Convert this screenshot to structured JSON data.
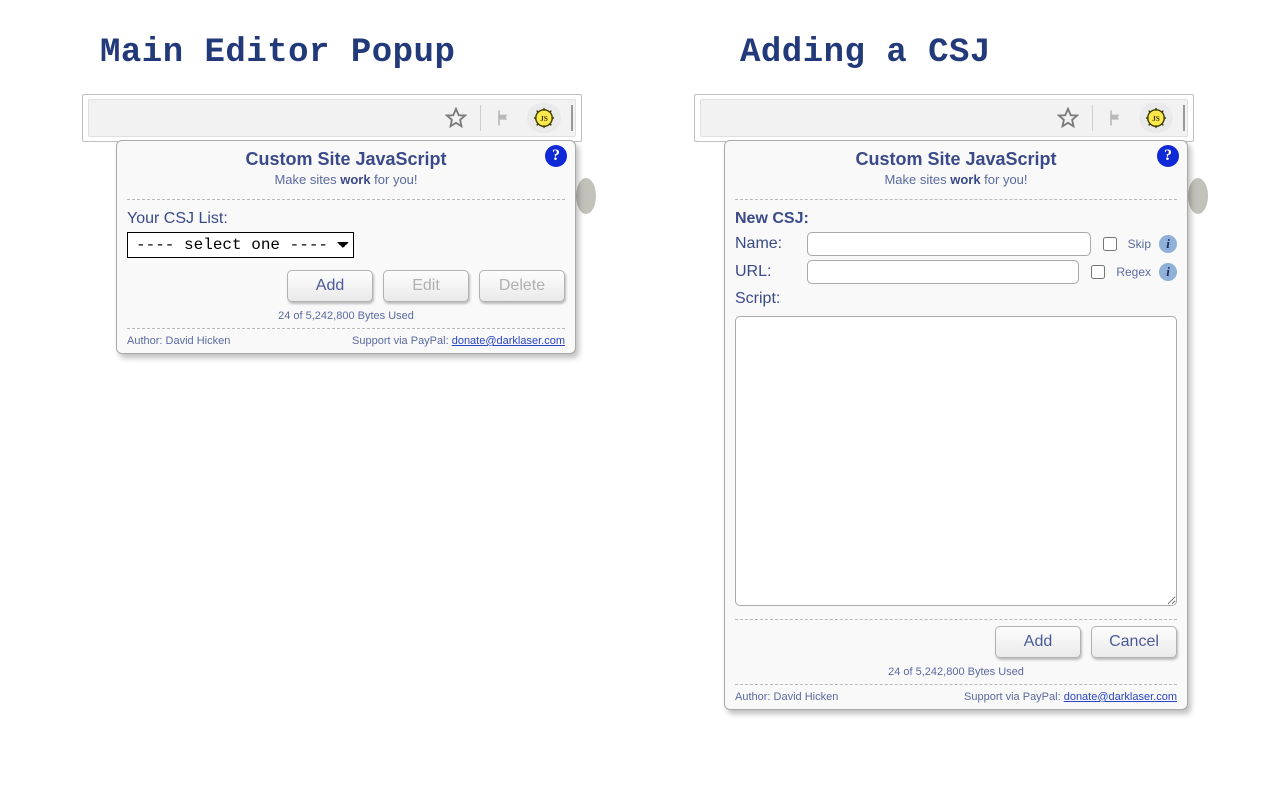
{
  "headings": {
    "left": "Main Editor Popup",
    "right": "Adding a CSJ"
  },
  "popup_header": {
    "title": "Custom Site JavaScript",
    "subtitle_prefix": "Make sites ",
    "subtitle_bold": "work",
    "subtitle_suffix": " for you!",
    "help_symbol": "?"
  },
  "left_popup": {
    "list_label": "Your CSJ List:",
    "select_placeholder": "---- select one ----",
    "buttons": {
      "add": "Add",
      "edit": "Edit",
      "delete": "Delete"
    }
  },
  "right_popup": {
    "section_label": "New CSJ:",
    "name_label": "Name:",
    "url_label": "URL:",
    "script_label": "Script:",
    "skip_label": "Skip",
    "regex_label": "Regex",
    "info_symbol": "i",
    "buttons": {
      "add": "Add",
      "cancel": "Cancel"
    }
  },
  "bytes_line": "24 of 5,242,800 Bytes Used",
  "footer": {
    "author": "Author: David Hicken",
    "support_prefix": "Support via PayPal: ",
    "support_link_text": "donate@darklaser.com"
  }
}
